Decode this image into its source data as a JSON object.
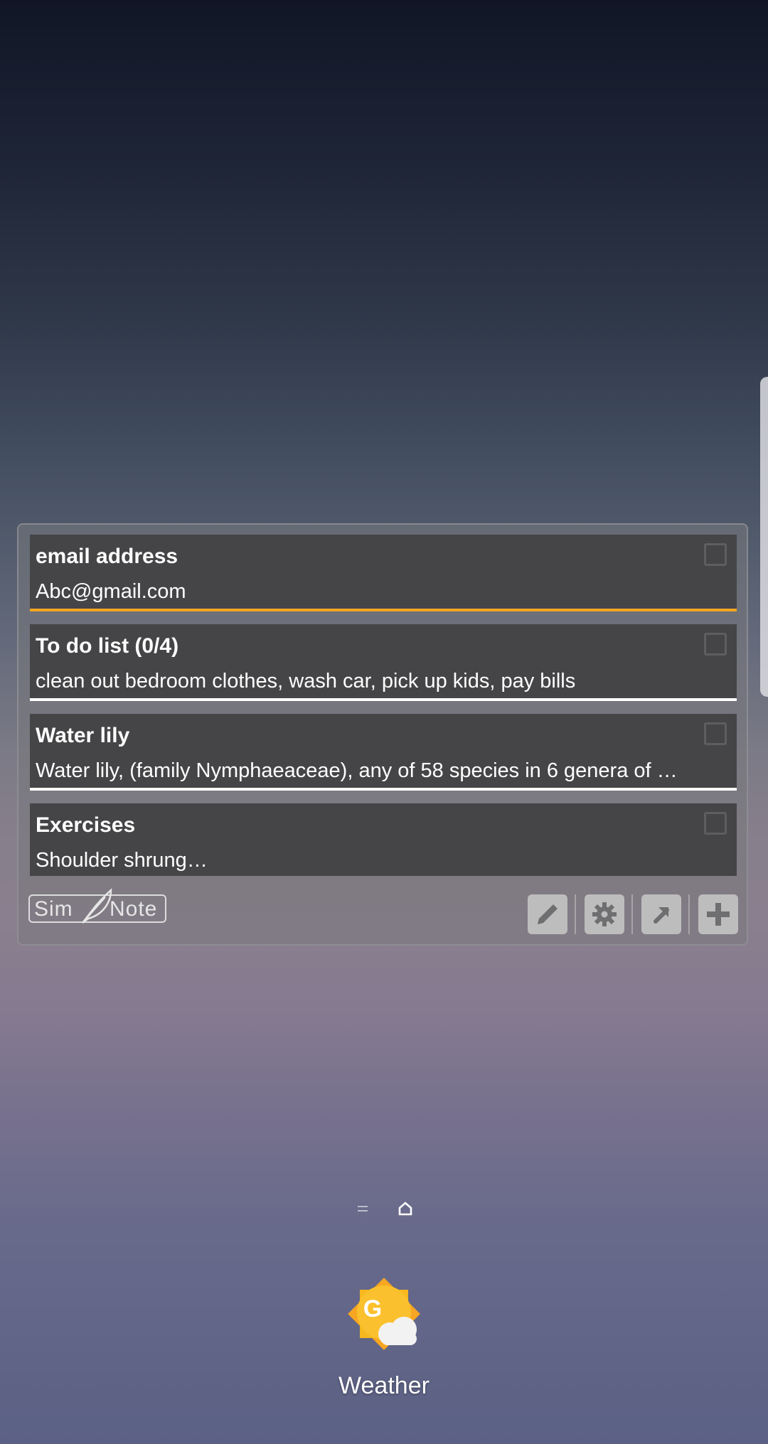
{
  "notes": [
    {
      "title": "email address",
      "body": "Abc@gmail.com",
      "color": "#f3a521"
    },
    {
      "title": "To do list (0/4)",
      "body": "clean out bedroom clothes, wash car, pick up kids, pay bills",
      "color": "#ffffff"
    },
    {
      "title": "Water lily",
      "body": "Water lily, (family Nymphaeaceae), any of 58 species in 6 genera of …",
      "color": "#ffffff"
    },
    {
      "title": "Exercises",
      "body": "Shoulder shrung…",
      "color": "#2e8b57"
    }
  ],
  "widget": {
    "logo_part1": "Sim",
    "logo_part2": "Note",
    "toolbar_icons": [
      "pencil-icon",
      "gear-icon",
      "arrow-up-right-icon",
      "plus-icon"
    ]
  },
  "home": {
    "page_indicator": [
      "menu-lines-icon",
      "home-icon"
    ],
    "apps": [
      {
        "label": "Weather",
        "icon": "weather-icon"
      }
    ]
  }
}
